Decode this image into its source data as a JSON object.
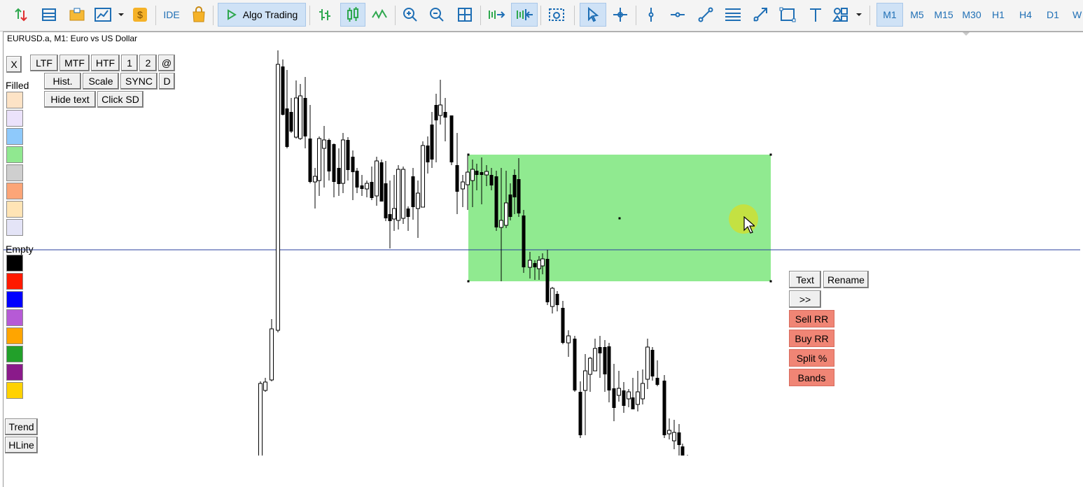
{
  "toolbar": {
    "ide_label": "IDE",
    "algo_label": "Algo Trading",
    "timeframes": [
      "M1",
      "M5",
      "M15",
      "M30",
      "H1",
      "H4",
      "D1",
      "W"
    ],
    "active_timeframe": "M1"
  },
  "chart": {
    "title": "EURUSD.a, M1:  Euro vs US Dollar",
    "rectangle_color": "#90ea90",
    "hline_color": "#2a3f9e"
  },
  "panel": {
    "close_label": "X",
    "tf_buttons": [
      "LTF",
      "MTF",
      "HTF",
      "1",
      "2",
      "@"
    ],
    "row2": [
      "Hist.",
      "Scale",
      "SYNC",
      "D"
    ],
    "row3": [
      "Hide text",
      "Click SD"
    ],
    "filled_label": "Filled",
    "empty_label": "Empty",
    "filled_colors": [
      "#fde3c6",
      "#ebe2fb",
      "#8ec9fb",
      "#90e890",
      "#cfcfcf",
      "#fca577",
      "#ffe4b5",
      "#e4e4f7"
    ],
    "empty_colors": [
      "#000000",
      "#ff1a00",
      "#0000ff",
      "#b65ad6",
      "#ffa500",
      "#22a02a",
      "#8a1a8a",
      "#ffd200"
    ],
    "trend_label": "Trend",
    "hline_label": "HLine"
  },
  "object_menu": {
    "text_label": "Text",
    "rename_label": "Rename",
    "more_label": ">>",
    "sell_label": "Sell RR",
    "buy_label": "Buy RR",
    "split_label": "Split %",
    "bands_label": "Bands"
  }
}
